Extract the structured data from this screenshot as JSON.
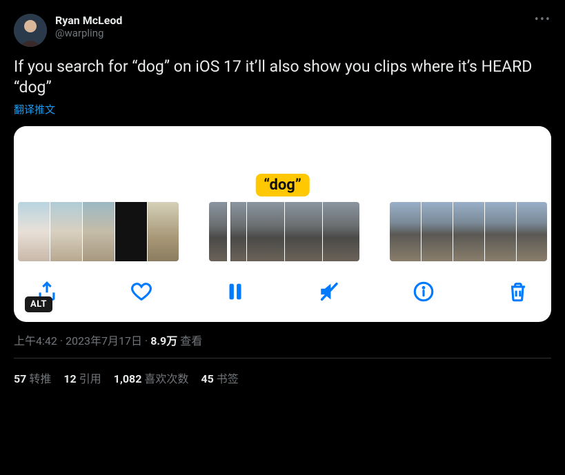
{
  "author": {
    "display_name": "Ryan McLeod",
    "handle": "@warpling"
  },
  "tweet_text": "If you search for “dog” on iOS 17 it’ll also show you clips where it’s HEARD “dog”",
  "translate_label": "翻译推文",
  "media": {
    "tag_text": "“dog”",
    "alt_badge": "ALT",
    "toolbar": {
      "share": "share-icon",
      "like": "heart-icon",
      "pause": "pause-icon",
      "mute": "speaker-muted-icon",
      "info": "info-icon",
      "trash": "trash-icon"
    }
  },
  "meta": {
    "time": "上午4:42",
    "sep1": " · ",
    "date": "2023年7月17日",
    "sep2": " · ",
    "views_value": "8.9万",
    "views_label": " 查看"
  },
  "stats": {
    "retweets_value": "57",
    "retweets_label": "转推",
    "quotes_value": "12",
    "quotes_label": "引用",
    "likes_value": "1,082",
    "likes_label": "喜欢次数",
    "bookmarks_value": "45",
    "bookmarks_label": "书签"
  }
}
